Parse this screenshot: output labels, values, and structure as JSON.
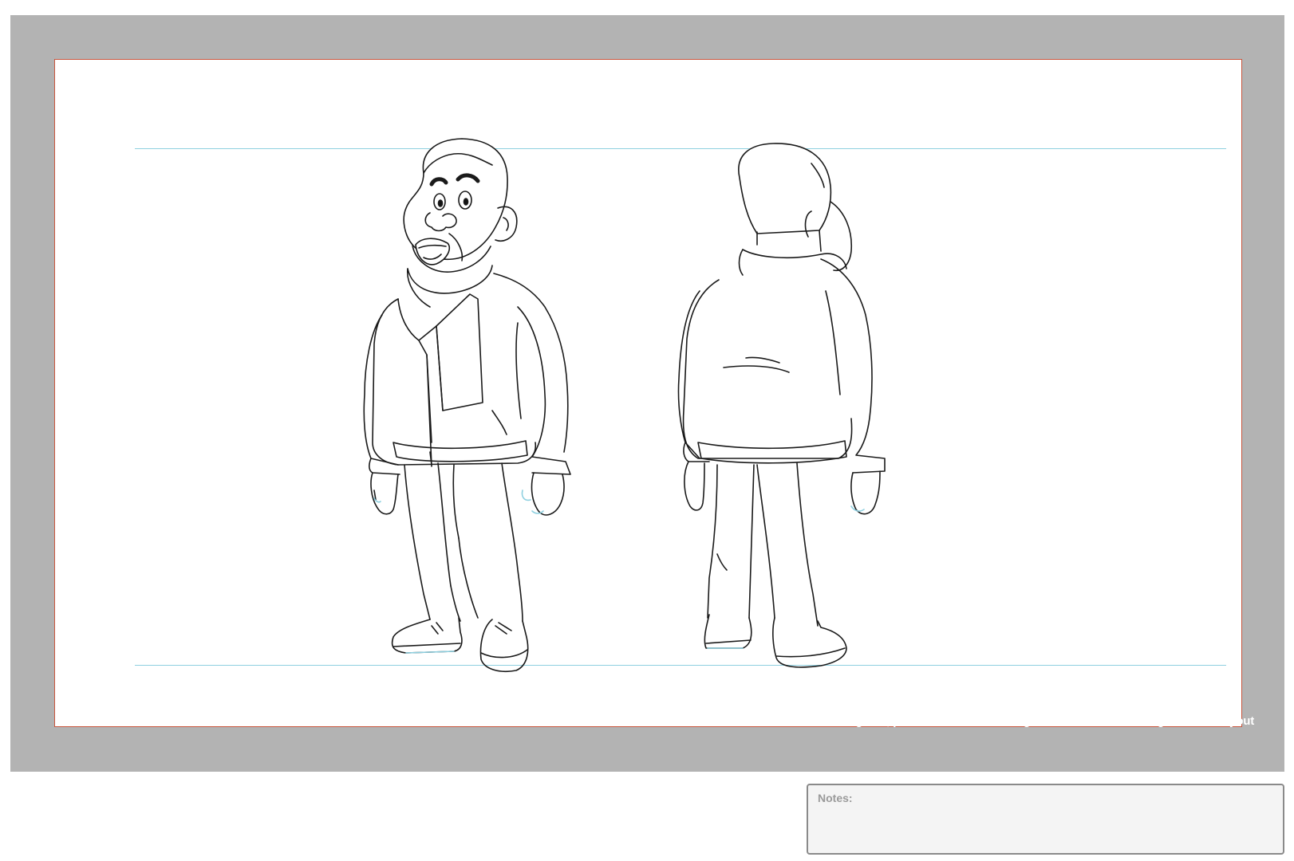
{
  "field_guide": {
    "caption": "field guide, please switch off if design doesn't need to be registered to layout",
    "frame_color": "#b3b3b3",
    "border_color": "#c8553d",
    "guide_line_color": "#8fd0e0"
  },
  "notes": {
    "label": "Notes:",
    "value": ""
  }
}
